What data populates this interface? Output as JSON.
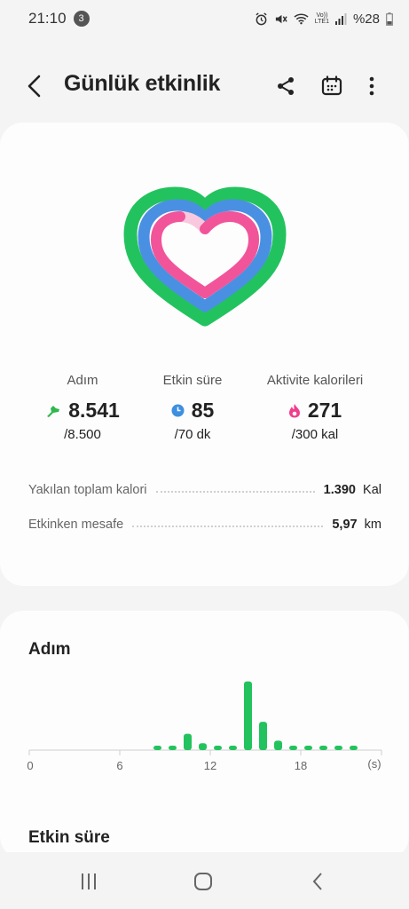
{
  "status_bar": {
    "time": "21:10",
    "notification_count": "3",
    "volte_label": "Vo))",
    "lte_label": "LTE1",
    "battery": "%28"
  },
  "header": {
    "title": "Günlük etkinlik",
    "back_icon": "back-arrow-icon",
    "share_icon": "share-icon",
    "calendar_icon": "calendar-icon",
    "more_icon": "more-vertical-icon"
  },
  "rings": {
    "steps_progress": 1.0,
    "active_time_progress": 1.0,
    "calories_progress": 0.9,
    "colors": {
      "steps": "#22c35e",
      "active_time": "#4a90e2",
      "calories": "#f2549a"
    }
  },
  "stats": [
    {
      "label": "Adım",
      "value": "8.541",
      "goal": "/8.500",
      "icon": "shoe-icon",
      "color": "#2eb84d"
    },
    {
      "label": "Etkin süre",
      "value": "85",
      "goal": "/70 dk",
      "icon": "clock-icon",
      "color": "#3d8fe0"
    },
    {
      "label": "Aktivite kalorileri",
      "value": "271",
      "goal": "/300 kal",
      "icon": "flame-icon",
      "color": "#f03d8c"
    }
  ],
  "summary": [
    {
      "label": "Yakılan toplam kalori",
      "value": "1.390",
      "unit": "Kal"
    },
    {
      "label": "Etkinken mesafe",
      "value": "5,97",
      "unit": "km"
    }
  ],
  "steps_section": {
    "title": "Adım"
  },
  "chart_data": {
    "type": "bar",
    "title": "Adım",
    "xlabel": "(s)",
    "ylabel": "",
    "x_ticks": [
      "0",
      "6",
      "12",
      "18"
    ],
    "x_unit": "(s)",
    "categories": [
      "0",
      "1",
      "2",
      "3",
      "4",
      "5",
      "6",
      "7",
      "8",
      "9",
      "10",
      "11",
      "12",
      "13",
      "14",
      "15",
      "16",
      "17",
      "18",
      "19",
      "20",
      "21",
      "22",
      "23"
    ],
    "values": [
      0,
      0,
      0,
      0,
      0,
      0,
      0,
      0,
      40,
      40,
      190,
      80,
      40,
      40,
      800,
      330,
      110,
      40,
      40,
      40,
      40,
      40,
      0,
      0
    ],
    "ylim": [
      0,
      900
    ],
    "color": "#22c35e",
    "grid": false
  },
  "active_time_section": {
    "title": "Etkin süre"
  },
  "nav": {
    "recents_icon": "recents-icon",
    "home_icon": "home-icon",
    "back_icon": "nav-back-icon"
  }
}
